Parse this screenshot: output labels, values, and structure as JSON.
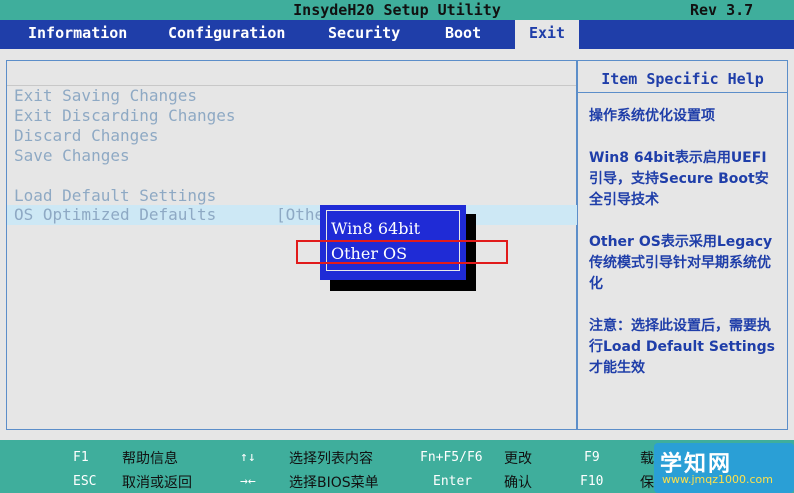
{
  "title": "InsydeH20 Setup Utility",
  "revision": "Rev 3.7",
  "tabs": [
    {
      "label": "Information"
    },
    {
      "label": "Configuration"
    },
    {
      "label": "Security"
    },
    {
      "label": "Boot"
    },
    {
      "label": "Exit",
      "active": true
    }
  ],
  "menu": [
    {
      "label": "Exit Saving Changes"
    },
    {
      "label": "Exit Discarding Changes"
    },
    {
      "label": "Discard Changes"
    },
    {
      "label": "Save Changes"
    },
    {
      "label": "Load Default Settings"
    },
    {
      "label": "OS Optimized Defaults",
      "value": "[Othe",
      "selected": true
    }
  ],
  "help": {
    "header": "Item Specific Help",
    "paragraphs": [
      "操作系统优化设置项",
      "Win8 64bit表示启用UEFI引导，支持Secure Boot安全引导技术",
      "Other OS表示采用Legacy传统模式引导针对早期系统优化",
      "注意：选择此设置后，需要执行Load Default Settings才能生效"
    ]
  },
  "popup": {
    "options": [
      "Win8 64bit",
      "Other OS"
    ],
    "highlighted": "Other OS"
  },
  "footer": {
    "row1": [
      {
        "key": "F1",
        "desc": "帮助信息"
      },
      {
        "key": "↑↓",
        "desc": "选择列表内容"
      },
      {
        "key": "Fn+F5/F6",
        "desc": "更改"
      },
      {
        "key": "F9",
        "desc": "载"
      }
    ],
    "row2": [
      {
        "key": "ESC",
        "desc": "取消或返回"
      },
      {
        "key": "→←",
        "desc": "选择BIOS菜单"
      },
      {
        "key": "Enter",
        "desc": "确认"
      },
      {
        "key": "F10",
        "desc": "保"
      }
    ]
  },
  "watermark": {
    "logo": "学知网",
    "url": "www.jmqz1000.com"
  },
  "colors": {
    "title_bar": "#3fae9c",
    "menu_bar": "#1f3ea9",
    "menu_text_disabled": "#8ea9c4",
    "help_text": "#1f3ea9",
    "popup_bg": "#1f2bd6",
    "highlight_box": "#e11b1b"
  }
}
